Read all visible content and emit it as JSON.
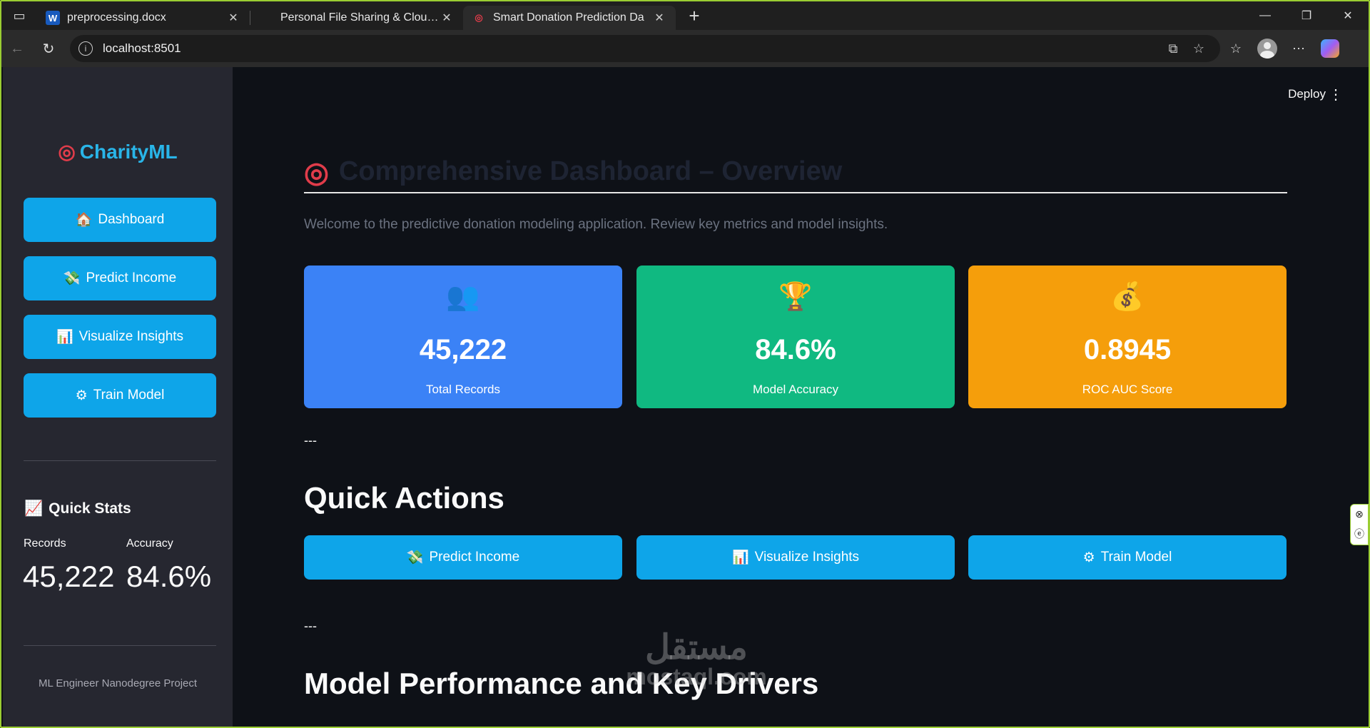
{
  "browser": {
    "tabs": [
      {
        "title": "preprocessing.docx",
        "icon": "word-icon"
      },
      {
        "title": "Personal File Sharing & Cloud Sto",
        "icon": "microsoft-icon"
      },
      {
        "title": "Smart Donation Prediction Da",
        "icon": "target-icon"
      }
    ],
    "url": "localhost:8501"
  },
  "app": {
    "deploy_label": "Deploy",
    "sidebar": {
      "brand": "CharityML",
      "nav": [
        {
          "icon": "🏠",
          "label": "Dashboard"
        },
        {
          "icon": "💸",
          "label": "Predict Income"
        },
        {
          "icon": "📊",
          "label": "Visualize Insights"
        },
        {
          "icon": "⚙",
          "label": "Train Model"
        }
      ],
      "quick_stats": {
        "title": "Quick Stats",
        "records_label": "Records",
        "records_value": "45,222",
        "accuracy_label": "Accuracy",
        "accuracy_value": "84.6%"
      },
      "footer": "ML Engineer Nanodegree Project"
    },
    "main": {
      "title": "Comprehensive Dashboard – Overview",
      "welcome": "Welcome to the predictive donation modeling application. Review key metrics and model insights.",
      "cards": [
        {
          "icon": "👥",
          "value": "45,222",
          "label": "Total Records",
          "color": "#3b82f6"
        },
        {
          "icon": "🏆",
          "value": "84.6%",
          "label": "Model Accuracy",
          "color": "#10b981"
        },
        {
          "icon": "💰",
          "value": "0.8945",
          "label": "ROC AUC Score",
          "color": "#f59e0b"
        }
      ],
      "hr_text": "---",
      "quick_actions_title": "Quick Actions",
      "quick_actions": [
        {
          "icon": "💸",
          "label": "Predict Income"
        },
        {
          "icon": "📊",
          "label": "Visualize Insights"
        },
        {
          "icon": "⚙",
          "label": "Train Model"
        }
      ],
      "performance_title": "Model Performance and Key Drivers"
    },
    "watermark": {
      "line1": "مستقل",
      "line2": "mostaql.com"
    }
  },
  "colors": {
    "accent": "#0ea5e9",
    "brand": "#29b5e8",
    "sidebar_bg": "#262730",
    "main_bg": "#0e1117"
  }
}
